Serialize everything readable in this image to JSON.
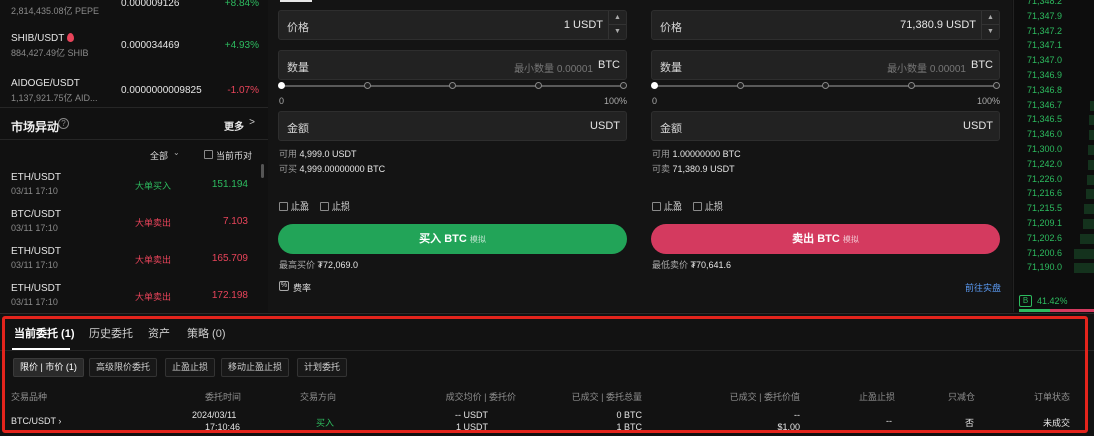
{
  "left": {
    "coins": [
      {
        "symbol": "",
        "volume": "2,814,435.08亿 PEPE",
        "price": "0.000009126",
        "change": "+8.84%",
        "color": "#2dbb5f"
      },
      {
        "symbol": "SHIB/USDT",
        "volume": "884,427.49亿 SHIB",
        "price": "0.000034469",
        "change": "+4.93%",
        "color": "#2dbb5f",
        "hot": true
      },
      {
        "symbol": "AIDOGE/USDT",
        "volume": "1,137,921.75亿 AID...",
        "price": "0.0000000009825",
        "change": "-1.07%",
        "color": "#e8445a"
      }
    ],
    "market_moves_title": "市场异动",
    "help_icon": "?",
    "more_label": "更多",
    "more_chevron": ">",
    "filter_all": "全部",
    "filter_chevron": "⌄",
    "filter_current": "当前币对",
    "moves": [
      {
        "symbol": "ETH/USDT",
        "time": "03/11 17:10",
        "type": "大单买入",
        "amount": "151.194",
        "color": "#2dbb5f"
      },
      {
        "symbol": "BTC/USDT",
        "time": "03/11 17:10",
        "type": "大单卖出",
        "amount": "7.103",
        "color": "#e8445a"
      },
      {
        "symbol": "ETH/USDT",
        "time": "03/11 17:10",
        "type": "大单卖出",
        "amount": "165.709",
        "color": "#e8445a"
      },
      {
        "symbol": "ETH/USDT",
        "time": "03/11 17:10",
        "type": "大单卖出",
        "amount": "172.198",
        "color": "#e8445a"
      }
    ]
  },
  "buy_form": {
    "price_label": "价格",
    "price_value": "1",
    "price_unit": "USDT",
    "qty_label": "数量",
    "qty_placeholder": "最小数量 0.00001",
    "qty_unit": "BTC",
    "slider_min": "0",
    "slider_max": "100%",
    "amount_label": "金额",
    "amount_unit": "USDT",
    "avail_label": "可用",
    "avail_value": "4,999.0 USDT",
    "can_label": "可买",
    "can_value": "4,999.00000000 BTC",
    "tp_label": "止盈",
    "sl_label": "止损",
    "button_label": "买入 BTC",
    "button_sub": "模拟",
    "best_label": "最高买价",
    "best_value": "₮72,069.0"
  },
  "sell_form": {
    "price_label": "价格",
    "price_value": "71,380.9",
    "price_unit": "USDT",
    "qty_label": "数量",
    "qty_placeholder": "最小数量 0.00001",
    "qty_unit": "BTC",
    "slider_min": "0",
    "slider_max": "100%",
    "amount_label": "金额",
    "amount_unit": "USDT",
    "avail_label": "可用",
    "avail_value": "1.00000000 BTC",
    "can_label": "可卖",
    "can_value": "71,380.9 USDT",
    "tp_label": "止盈",
    "sl_label": "止损",
    "button_label": "卖出 BTC",
    "button_sub": "模拟",
    "best_label": "最低卖价",
    "best_value": "₮70,641.6"
  },
  "fee_icon": "%",
  "fee_label": "费率",
  "go_live_label": "前往实盘",
  "stepper_up": "▲",
  "stepper_down": "▼",
  "book": {
    "prices": [
      "71,348.2",
      "71,347.9",
      "71,347.2",
      "71,347.1",
      "71,347.0",
      "71,346.9",
      "71,346.8",
      "71,346.7",
      "71,346.5",
      "71,346.0",
      "71,300.0",
      "71,242.0",
      "71,226.0",
      "71,216.6",
      "71,215.5",
      "71,209.1",
      "71,202.6",
      "71,200.6",
      "71,190.0"
    ],
    "depth": [
      0,
      0,
      0,
      0,
      0,
      0,
      0,
      0.2,
      0.25,
      0.25,
      0.3,
      0.3,
      0.35,
      0.4,
      0.5,
      0.55,
      0.7,
      1.0,
      1.0
    ],
    "buy_badge": "B",
    "buy_pct": "41.42%",
    "buy_ratio": 0.4142
  },
  "bottom": {
    "tabs": [
      "当前委托 (1)",
      "历史委托",
      "资产",
      "策略 (0)"
    ],
    "filters": [
      "限价 | 市价 (1)",
      "高级限价委托",
      "止盈止损",
      "移动止盈止损",
      "计划委托"
    ],
    "headers": [
      "交易品种",
      "委托时间",
      "交易方向",
      "成交均价 | 委托价",
      "已成交 | 委托总量",
      "已成交 | 委托价值",
      "止盈止损",
      "只减仓",
      "订单状态"
    ],
    "row": {
      "symbol": "BTC/USDT ›",
      "date": "2024/03/11",
      "time": "17:10:46",
      "side": "买入",
      "avg_price": "-- USDT",
      "order_price": "1 USDT",
      "filled_qty": "0 BTC",
      "total_qty": "1 BTC",
      "filled_value": "--",
      "order_value": "$1.00",
      "tpsl": "--",
      "reduce_only": "否",
      "status": "未成交"
    }
  }
}
